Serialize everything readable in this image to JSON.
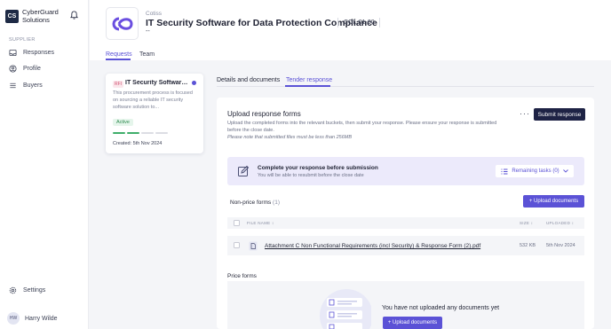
{
  "brand": {
    "initials": "CS",
    "name": "CyberGuard Solutions"
  },
  "sidebar": {
    "section_label": "SUPPLIER",
    "items": [
      {
        "label": "Responses",
        "icon": "inbox-icon"
      },
      {
        "label": "Profile",
        "icon": "user-circle-icon"
      },
      {
        "label": "Buyers",
        "icon": "list-icon"
      }
    ],
    "settings_label": "Settings",
    "user": {
      "initials": "HW",
      "name": "Harry Wilde"
    }
  },
  "project": {
    "client": "Cotiss",
    "title": "IT Security Software for Data Protection Compliance",
    "code": "COL-01-00",
    "dash": "--"
  },
  "tabs": [
    "Requests",
    "Team"
  ],
  "request_card": {
    "badge": "RFI",
    "title": "IT Security Software...",
    "description": "This procurement process is focused on sourcing a reliable IT security software solution to...",
    "status": "Active",
    "progress_complete": 2,
    "progress_total": 4,
    "created": "Created: 5th Nov 2024"
  },
  "subtabs": [
    "Details and documents",
    "Tender response"
  ],
  "panel": {
    "title": "Upload response forms",
    "description": "Upload the completed forms into the relevant buckets, then submit your response. Please ensure your response is submitted before the close date.",
    "note": "Please note that submitted files must be less than 256MB",
    "more_label": "···",
    "submit_label": "Submit response"
  },
  "banner": {
    "title": "Complete your response before submission",
    "subtitle": "You will be able to resubmit before the close date",
    "remaining_label": "Remaining tasks (0)"
  },
  "non_price": {
    "title": "Non-price forms",
    "count": "(1)",
    "upload_label": "+ Upload documents",
    "columns": {
      "file_name": "FILE NAME",
      "size": "SIZE",
      "uploaded": "UPLOADED"
    },
    "rows": [
      {
        "name": "Attachment C Non Functional Requirements (incl Security) & Response Form (2).pdf",
        "size": "532 KB",
        "uploaded": "5th Nov 2024"
      }
    ]
  },
  "price": {
    "title": "Price forms",
    "empty_text": "You have not uploaded any documents yet",
    "upload_label": "+ Upload documents"
  },
  "colors": {
    "accent": "#5b52d6",
    "dark_button": "#1e2345",
    "active_green": "#2e8a4e",
    "progress_done": "#3fae6a"
  }
}
